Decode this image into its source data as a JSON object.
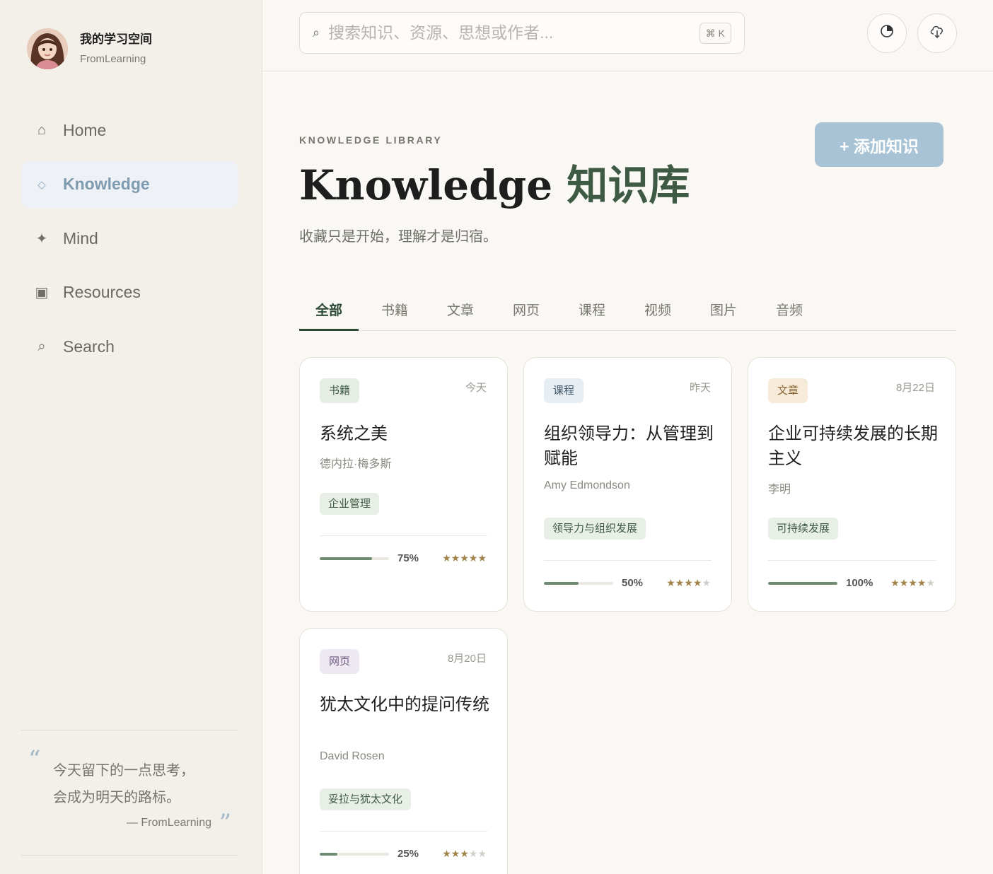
{
  "profile": {
    "name": "我的学习空间",
    "subtitle": "FromLearning"
  },
  "nav": [
    {
      "icon": "home-icon",
      "glyph": "⌂",
      "label": "Home",
      "active": false
    },
    {
      "icon": "diamond-icon",
      "glyph": "◇",
      "label": "Knowledge",
      "active": true
    },
    {
      "icon": "sparkle-icon",
      "glyph": "✦",
      "label": "Mind",
      "active": false
    },
    {
      "icon": "resources-icon",
      "glyph": "▣",
      "label": "Resources",
      "active": false
    },
    {
      "icon": "search-icon",
      "glyph": "⌕",
      "label": "Search",
      "active": false
    }
  ],
  "quote": {
    "line1": "今天留下的一点思考，",
    "line2": "会成为明天的路标。",
    "author": "— FromLearning"
  },
  "search": {
    "placeholder": "搜索知识、资源、思想或作者...",
    "shortcut": "⌘ K"
  },
  "header": {
    "eyebrow": "KNOWLEDGE LIBRARY",
    "title_en": "Knowledge",
    "title_cn": "知识库",
    "subtitle": "收藏只是开始，理解才是归宿。",
    "add_button": "+ 添加知识"
  },
  "tabs": [
    "全部",
    "书籍",
    "文章",
    "网页",
    "课程",
    "视频",
    "图片",
    "音频"
  ],
  "active_tab": 0,
  "cards": [
    {
      "type": "书籍",
      "type_class": "book",
      "date": "今天",
      "title": "系统之美",
      "author": "德内拉·梅多斯",
      "tag": "企业管理",
      "progress": 75,
      "progress_label": "75%",
      "rating": 5
    },
    {
      "type": "课程",
      "type_class": "course",
      "date": "昨天",
      "title": "组织领导力：从管理到赋能",
      "author": "Amy Edmondson",
      "tag": "领导力与组织发展",
      "progress": 50,
      "progress_label": "50%",
      "rating": 4
    },
    {
      "type": "文章",
      "type_class": "article",
      "date": "8月22日",
      "title": "企业可持续发展的长期主义",
      "author": "李明",
      "tag": "可持续发展",
      "progress": 100,
      "progress_label": "100%",
      "rating": 4
    },
    {
      "type": "网页",
      "type_class": "web",
      "date": "8月20日",
      "title": "犹太文化中的提问传统",
      "author": "David Rosen",
      "tag": "妥拉与犹太文化",
      "progress": 25,
      "progress_label": "25%",
      "rating": 3
    }
  ],
  "colors": {
    "accent": "#2c4a34",
    "nav_active": "#7f9bb0",
    "button": "#a9c3d6",
    "star": "#a2844a"
  }
}
